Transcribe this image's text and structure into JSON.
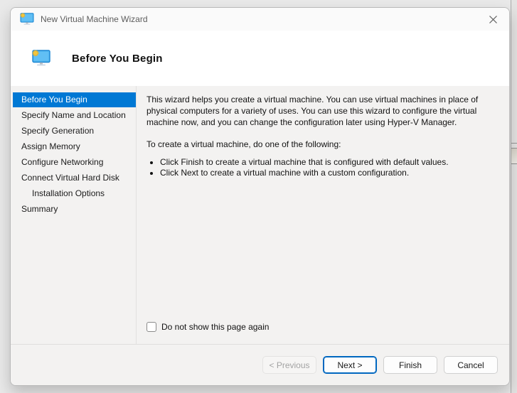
{
  "window": {
    "title": "New Virtual Machine Wizard",
    "icon": "vm-monitor-with-gear"
  },
  "header": {
    "title": "Before You Begin",
    "icon": "vm-monitor-with-gear"
  },
  "sidebar": {
    "items": [
      {
        "label": "Before You Begin",
        "selected": true,
        "indent": false
      },
      {
        "label": "Specify Name and Location",
        "selected": false,
        "indent": false
      },
      {
        "label": "Specify Generation",
        "selected": false,
        "indent": false
      },
      {
        "label": "Assign Memory",
        "selected": false,
        "indent": false
      },
      {
        "label": "Configure Networking",
        "selected": false,
        "indent": false
      },
      {
        "label": "Connect Virtual Hard Disk",
        "selected": false,
        "indent": false
      },
      {
        "label": "Installation Options",
        "selected": false,
        "indent": true
      },
      {
        "label": "Summary",
        "selected": false,
        "indent": false
      }
    ]
  },
  "content": {
    "intro": "This wizard helps you create a virtual machine. You can use virtual machines in place of physical computers for a variety of uses. You can use this wizard to configure the virtual machine now, and you can change the configuration later using Hyper-V Manager.",
    "prompt": "To create a virtual machine, do one of the following:",
    "bullets": [
      "Click Finish to create a virtual machine that is configured with default values.",
      "Click Next to create a virtual machine with a custom configuration."
    ],
    "checkbox_label": "Do not show this page again",
    "checkbox_checked": false
  },
  "footer": {
    "buttons": [
      {
        "label": "< Previous",
        "state": "disabled"
      },
      {
        "label": "Next >",
        "state": "default"
      },
      {
        "label": "Finish",
        "state": "normal"
      },
      {
        "label": "Cancel",
        "state": "normal"
      }
    ]
  },
  "colors": {
    "nav_selected": "#0078d4",
    "default_button_border": "#0067c0",
    "header_bg": "#ffffff",
    "body_bg": "#f3f2f1"
  }
}
